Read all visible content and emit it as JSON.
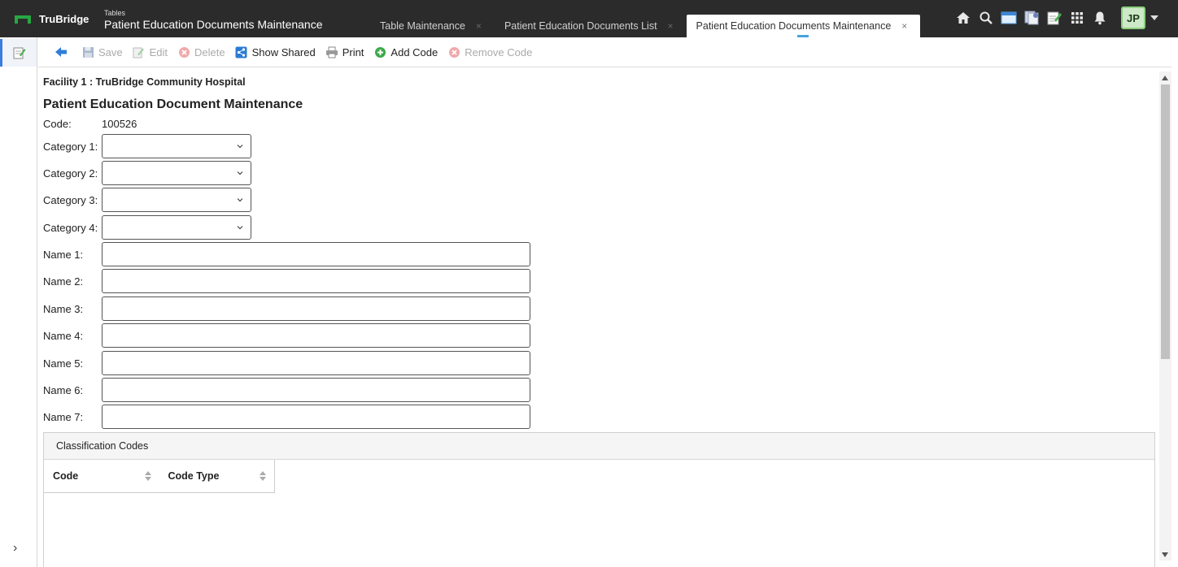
{
  "header": {
    "brand": "TruBridge",
    "context_small": "Tables",
    "context_title": "Patient Education Documents Maintenance",
    "tabs": [
      {
        "label": "Table Maintenance",
        "close": "×"
      },
      {
        "label": "Patient Education Documents List",
        "close": "×"
      },
      {
        "label": "Patient Education Documents Maintenance",
        "close": "×",
        "active": true
      }
    ],
    "icons": [
      "home-icon",
      "search-icon",
      "window-icon",
      "documents-icon",
      "notepad-icon",
      "apps-grid-icon",
      "bell-icon"
    ],
    "user_initials": "JP",
    "brand_color": "#27a844"
  },
  "toolbar": {
    "back_icon": "back-arrow-icon",
    "save": "Save",
    "edit": "Edit",
    "delete": "Delete",
    "show_shared": "Show Shared",
    "print": "Print",
    "add_code": "Add Code",
    "remove_code": "Remove Code"
  },
  "form": {
    "facility": "Facility 1 : TruBridge Community Hospital",
    "title": "Patient Education Document Maintenance",
    "code_label": "Code:",
    "code_value": "100526",
    "categories": [
      {
        "label": "Category 1:",
        "value": ""
      },
      {
        "label": "Category 2:",
        "value": ""
      },
      {
        "label": "Category 3:",
        "value": ""
      },
      {
        "label": "Category 4:",
        "value": ""
      }
    ],
    "names": [
      {
        "label": "Name 1:",
        "value": ""
      },
      {
        "label": "Name 2:",
        "value": ""
      },
      {
        "label": "Name 3:",
        "value": ""
      },
      {
        "label": "Name 4:",
        "value": ""
      },
      {
        "label": "Name 5:",
        "value": ""
      },
      {
        "label": "Name 6:",
        "value": ""
      },
      {
        "label": "Name 7:",
        "value": ""
      }
    ]
  },
  "classification": {
    "title": "Classification Codes",
    "columns": [
      "Code",
      "Code Type"
    ],
    "rows": []
  },
  "leftrail": {
    "active_icon": "notepad-icon",
    "expand": "›"
  }
}
